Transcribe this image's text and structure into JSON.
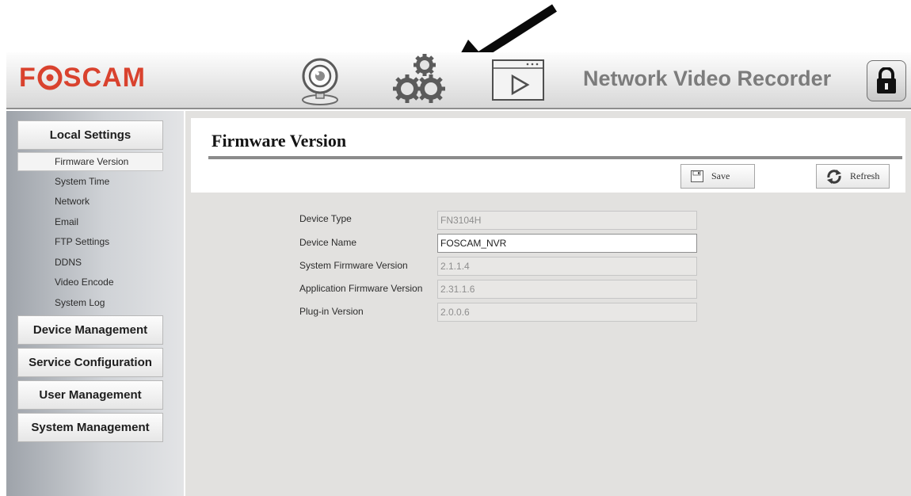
{
  "header": {
    "brand_prefix": "F",
    "brand_suffix": "SCAM",
    "title": "Network Video Recorder",
    "icons": [
      "webcam-icon",
      "gears-icon",
      "video-player-icon",
      "lock-icon"
    ]
  },
  "sidebar": {
    "sections": [
      {
        "label": "Local Settings",
        "expanded": true
      },
      {
        "label": "Device Management"
      },
      {
        "label": "Service Configuration"
      },
      {
        "label": "User Management"
      },
      {
        "label": "System Management"
      }
    ],
    "sub_items": [
      {
        "label": "Firmware Version",
        "active": true
      },
      {
        "label": "System Time"
      },
      {
        "label": "Network"
      },
      {
        "label": "Email"
      },
      {
        "label": "FTP Settings"
      },
      {
        "label": "DDNS"
      },
      {
        "label": "Video Encode"
      },
      {
        "label": "System Log"
      }
    ]
  },
  "main": {
    "title": "Firmware Version",
    "save_label": "Save",
    "refresh_label": "Refresh",
    "fields": [
      {
        "label": "Device Type",
        "value": "FN3104H",
        "editable": false
      },
      {
        "label": "Device Name",
        "value": "FOSCAM_NVR",
        "editable": true
      },
      {
        "label": "System Firmware Version",
        "value": "2.1.1.4",
        "editable": false
      },
      {
        "label": "Application Firmware Version",
        "value": "2.31.1.6",
        "editable": false
      },
      {
        "label": "Plug-in Version",
        "value": "2.0.0.6",
        "editable": false
      }
    ]
  },
  "colors": {
    "brand_red": "#d9422e",
    "header_title": "#7c7c7c",
    "panel_bg": "#e2e1df"
  }
}
